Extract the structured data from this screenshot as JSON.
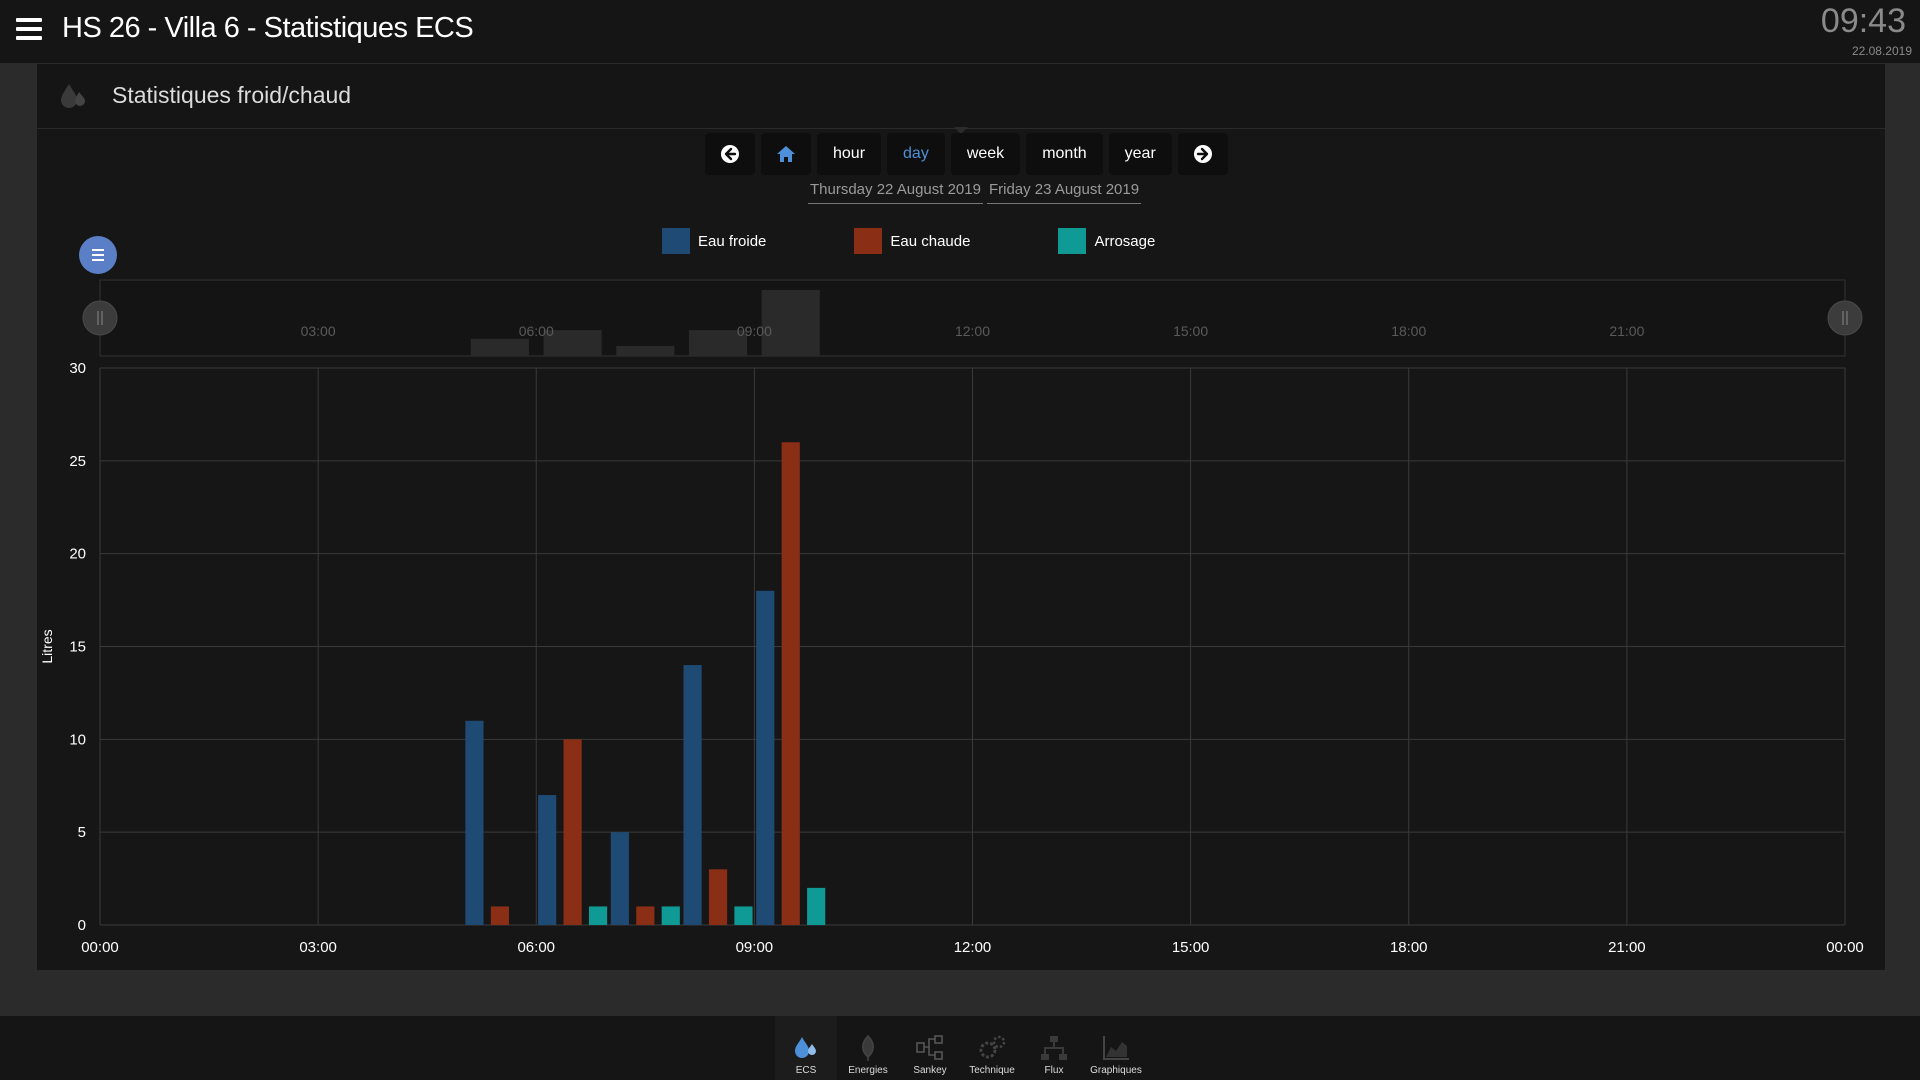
{
  "header": {
    "title": "HS 26 - Villa 6 - Statistiques ECS",
    "time": "09:43",
    "date": "22.08.2019"
  },
  "panel": {
    "title": "Statistiques froid/chaud",
    "icon": "water-drop-icon"
  },
  "nav": {
    "buttons": [
      {
        "label": "",
        "icon": "arrow-left-icon"
      },
      {
        "label": "",
        "icon": "home-icon"
      },
      {
        "label": "hour"
      },
      {
        "label": "day",
        "active": true
      },
      {
        "label": "week"
      },
      {
        "label": "month"
      },
      {
        "label": "year"
      },
      {
        "label": "",
        "icon": "arrow-right-icon"
      }
    ],
    "dates": [
      "Thursday 22 August 2019",
      "Friday 23 August 2019"
    ]
  },
  "legend": [
    {
      "name": "Eau froide",
      "color": "#1f4a73"
    },
    {
      "name": "Eau chaude",
      "color": "#8b2e16"
    },
    {
      "name": "Arrosage",
      "color": "#0f9a96"
    }
  ],
  "chart_data": {
    "type": "bar",
    "ylabel": "Litres",
    "ylim": [
      0,
      30
    ],
    "yticks": [
      0,
      5,
      10,
      15,
      20,
      25,
      30
    ],
    "xticks": [
      "00:00",
      "03:00",
      "06:00",
      "09:00",
      "12:00",
      "15:00",
      "18:00",
      "21:00",
      "00:00"
    ],
    "xlim_hours": [
      0,
      24
    ],
    "bar_hours": [
      5.5,
      6.5,
      7.5,
      8.5,
      9.5
    ],
    "series": [
      {
        "name": "Eau froide",
        "color": "#1f4a73",
        "values": [
          11,
          7,
          5,
          14,
          18
        ]
      },
      {
        "name": "Eau chaude",
        "color": "#8b2e16",
        "values": [
          1,
          10,
          1,
          3,
          26
        ]
      },
      {
        "name": "Arrosage",
        "color": "#0f9a96",
        "values": [
          0,
          1,
          1,
          1,
          2
        ]
      }
    ],
    "navigator_xticks": [
      "03:00",
      "06:00",
      "09:00",
      "12:00",
      "15:00",
      "18:00",
      "21:00"
    ],
    "grid": true
  },
  "tabs": [
    {
      "label": "ECS",
      "icon": "water-drop-icon",
      "active": true
    },
    {
      "label": "Energies",
      "icon": "leaf-icon"
    },
    {
      "label": "Sankey",
      "icon": "sankey-icon"
    },
    {
      "label": "Technique",
      "icon": "gears-icon"
    },
    {
      "label": "Flux",
      "icon": "network-icon"
    },
    {
      "label": "Graphiques",
      "icon": "area-chart-icon"
    }
  ]
}
